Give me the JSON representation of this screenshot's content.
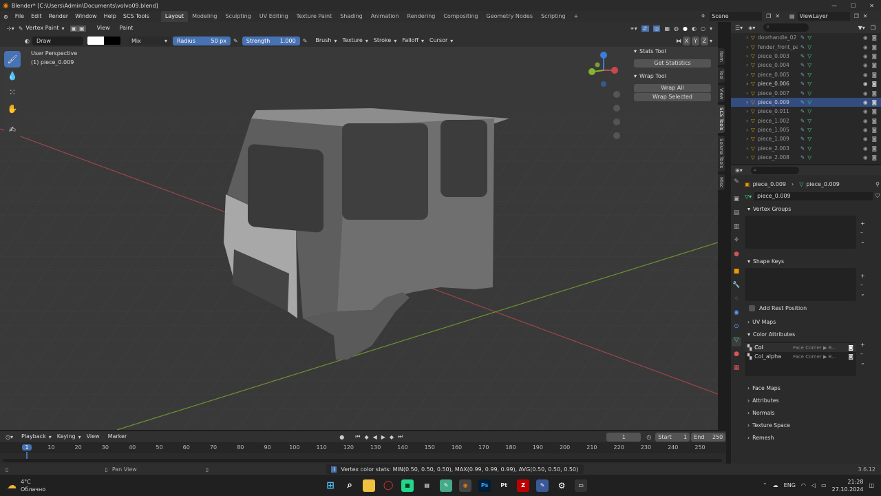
{
  "window": {
    "title": "Blender* [C:\\Users\\Admin\\Documents\\volvo09.blend]"
  },
  "menus": [
    "File",
    "Edit",
    "Render",
    "Window",
    "Help",
    "SCS Tools"
  ],
  "workspaces": [
    "Layout",
    "Modeling",
    "Sculpting",
    "UV Editing",
    "Texture Paint",
    "Shading",
    "Animation",
    "Rendering",
    "Compositing",
    "Geometry Nodes",
    "Scripting"
  ],
  "active_workspace": "Layout",
  "scene": {
    "name": "Scene",
    "view_layer": "ViewLayer"
  },
  "viewport_header": {
    "mode": "Vertex Paint",
    "view": "View",
    "paint": "Paint"
  },
  "tool_settings": {
    "brush_name": "Draw",
    "blend": "Mix",
    "radius_label": "Radius",
    "radius_value": "50 px",
    "strength_label": "Strength",
    "strength_value": "1.000",
    "brush": "Brush",
    "texture": "Texture",
    "stroke": "Stroke",
    "falloff": "Falloff",
    "cursor": "Cursor",
    "axes": [
      "X",
      "Y",
      "Z"
    ]
  },
  "viewport_info": {
    "view": "User Perspective",
    "object": "(1) piece_0.009"
  },
  "npanel": {
    "stats_title": "Stats Tool",
    "get_stats": "Get Statistics",
    "wrap_title": "Wrap Tool",
    "wrap_all": "Wrap All",
    "wrap_selected": "Wrap Selected"
  },
  "side_tabs": [
    "Item",
    "Tool",
    "View",
    "SCS Tools",
    "Soluna Tools",
    "Misc"
  ],
  "outliner": {
    "search_placeholder": "",
    "items": [
      {
        "name": "doorhandle_02",
        "selected": false,
        "bright": false
      },
      {
        "name": "fender_front_paint",
        "selected": false,
        "bright": false
      },
      {
        "name": "piece_0.003",
        "selected": false,
        "bright": false
      },
      {
        "name": "piece_0.004",
        "selected": false,
        "bright": false
      },
      {
        "name": "piece_0.005",
        "selected": false,
        "bright": false
      },
      {
        "name": "piece_0.006",
        "selected": false,
        "bright": true
      },
      {
        "name": "piece_0.007",
        "selected": false,
        "bright": false
      },
      {
        "name": "piece_0.009",
        "selected": true,
        "bright": true
      },
      {
        "name": "piece_0.011",
        "selected": false,
        "bright": false
      },
      {
        "name": "piece_1.002",
        "selected": false,
        "bright": false
      },
      {
        "name": "piece_1.005",
        "selected": false,
        "bright": false
      },
      {
        "name": "piece_1.009",
        "selected": false,
        "bright": false
      },
      {
        "name": "piece_2.003",
        "selected": false,
        "bright": false
      },
      {
        "name": "piece_2.008",
        "selected": false,
        "bright": false
      }
    ]
  },
  "properties": {
    "breadcrumb_object": "piece_0.009",
    "breadcrumb_mesh": "piece_0.009",
    "mesh_name": "piece_0.009",
    "vertex_groups": "Vertex Groups",
    "shape_keys": "Shape Keys",
    "add_rest_position": "Add Rest Position",
    "uv_maps": "UV Maps",
    "color_attributes": "Color Attributes",
    "color_attr_items": [
      {
        "name": "Col",
        "domain": "Face Corner ▶ B..."
      },
      {
        "name": "Col_alpha",
        "domain": "Face Corner ▶ B..."
      }
    ],
    "face_maps": "Face Maps",
    "attributes": "Attributes",
    "normals": "Normals",
    "texture_space": "Texture Space",
    "remesh": "Remesh"
  },
  "timeline": {
    "playback": "Playback",
    "keying": "Keying",
    "view": "View",
    "marker": "Marker",
    "current_frame": "1",
    "start_label": "Start",
    "start": "1",
    "end_label": "End",
    "end": "250",
    "ticks": [
      "1",
      "10",
      "20",
      "30",
      "40",
      "50",
      "60",
      "70",
      "80",
      "90",
      "100",
      "110",
      "120",
      "130",
      "140",
      "150",
      "160",
      "170",
      "180",
      "190",
      "200",
      "210",
      "220",
      "230",
      "240",
      "250"
    ]
  },
  "statusbar": {
    "pan_view": "Pan View",
    "message": "Vertex color stats: MIN(0.50, 0.50, 0.50), MAX(0.99, 0.99, 0.99), AVG(0.50, 0.50, 0.50)",
    "version": "3.6.12"
  },
  "taskbar": {
    "weather_temp": "4°C",
    "weather_desc": "Облачно",
    "lang": "ENG",
    "time": "21:28",
    "date": "27.10.2024"
  },
  "colors": {
    "accent": "#4772b3",
    "selection": "#334d80",
    "viewport_bg": "#393939",
    "x_axis": "#c8484e",
    "y_axis": "#86b52c",
    "z_axis": "#3b7ddc"
  }
}
